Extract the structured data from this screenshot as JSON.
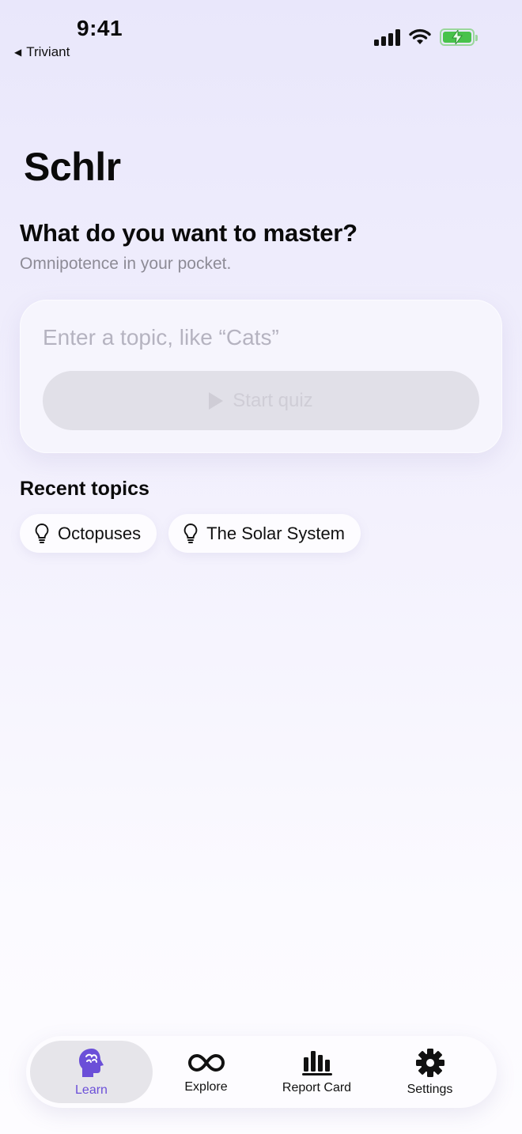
{
  "status_bar": {
    "time": "9:41",
    "back_app": "Triviant"
  },
  "app": {
    "title": "Schlr"
  },
  "hero": {
    "question": "What do you want to master?",
    "subtitle": "Omnipotence in your pocket."
  },
  "search": {
    "placeholder": "Enter a topic, like “Cats”",
    "value": "",
    "start_label": "Start quiz"
  },
  "recent": {
    "heading": "Recent topics",
    "items": [
      {
        "label": "Octopuses",
        "icon": "lightbulb-icon"
      },
      {
        "label": "The Solar System",
        "icon": "lightbulb-icon"
      }
    ]
  },
  "tabs": [
    {
      "label": "Learn",
      "icon": "brain-head-icon",
      "active": true
    },
    {
      "label": "Explore",
      "icon": "infinity-icon",
      "active": false
    },
    {
      "label": "Report Card",
      "icon": "bar-chart-icon",
      "active": false
    },
    {
      "label": "Settings",
      "icon": "gear-icon",
      "active": false
    }
  ],
  "colors": {
    "accent": "#6b4fd8",
    "battery": "#48c24b"
  }
}
